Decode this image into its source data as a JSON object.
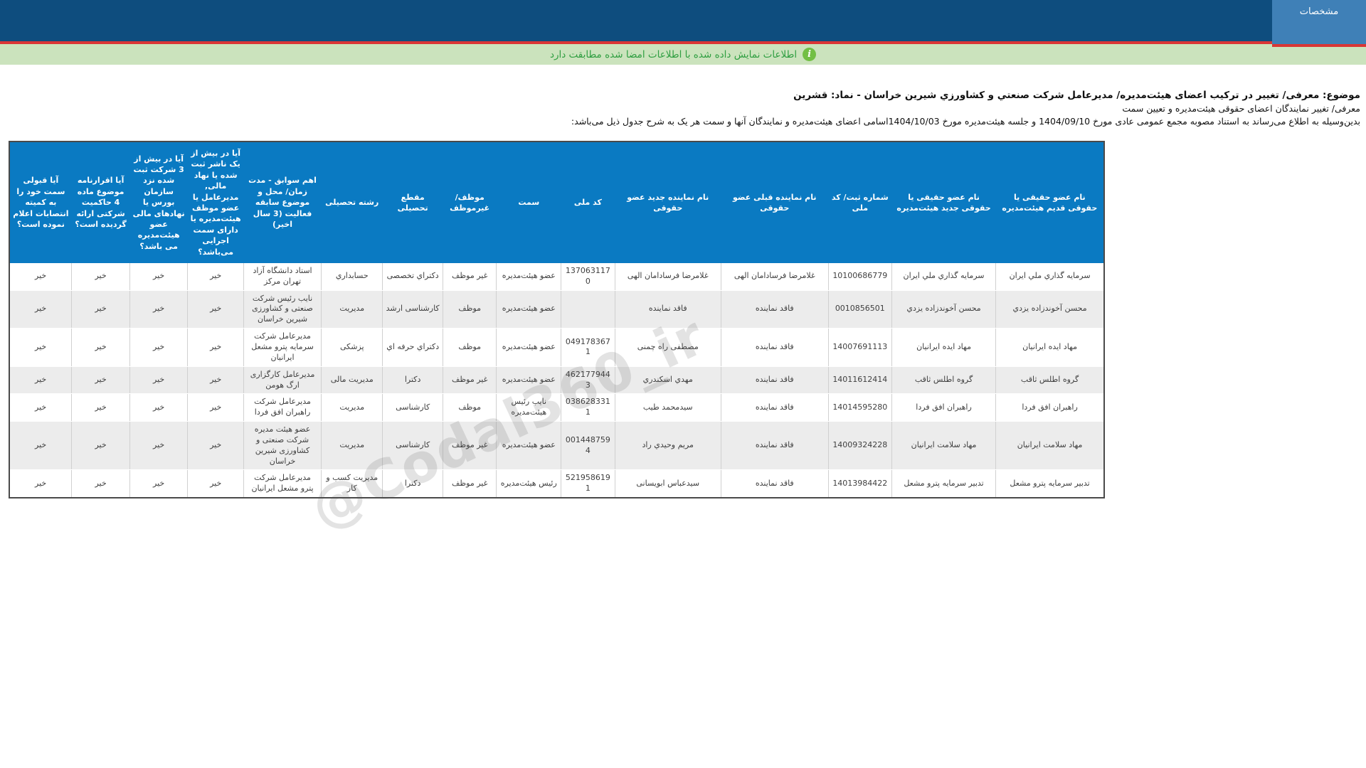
{
  "colors": {
    "navy": "#0e4d7e",
    "tab_blue": "#3f80b7",
    "red": "#d93636",
    "green_bg": "#cbe3bd",
    "green_text": "#2f9e41",
    "icon_green": "#72bf44",
    "accent_blue": "#0a7ac2"
  },
  "topbar": {
    "tab_label": "مشخصات"
  },
  "infobar": {
    "icon": "info-icon",
    "message": "اطلاعات نمایش داده شده با اطلاعات امضا شده مطابقت دارد"
  },
  "document": {
    "subject": "موضوع: معرفی/ تغییر در ترکیب اعضای هیئت‌مدیره/ مدیرعامل شرکت صنعتي و کشاورزي شیرین خراسان - نماد: قشرین",
    "subtitle": "معرفی/ تغییر نمایندگان اعضای حقوقی هیئت‌مدیره و تعیین سمت",
    "description": "بدین‌وسیله به اطلاع می‌رساند به استناد مصوبه مجمع عمومی عادی مورخ  1404/09/10  و جلسه هیئت‌مدیره مورخ 1404/10/03اسامی اعضای هیئت‌مدیره و نمایندگان آنها و سمت هر یک به شرح جدول ذیل می‌باشد:",
    "general_assembly_date": "1404/09/10",
    "board_meeting_date": "1404/10/03"
  },
  "table": {
    "columns": [
      "نام عضو حقیقی یا حقوقی قدیم هیئت‌مدیره",
      "نام عضو حقیقی یا حقوقی جدید هیئت‌مدیره",
      "شماره ثبت/ کد ملی",
      "نام نماینده قبلی عضو حقوقی",
      "نام نماینده جدید عضو حقوقی",
      "کد ملی",
      "سمت",
      "موظف/ غیرموظف",
      "مقطع تحصیلی",
      "رشته تحصیلی",
      "اهم سوابق - مدت زمان/ محل و موضوع سابقه فعالیت (3 سال اخیر)",
      "آیا در بیش از یک ناشر ثبت شده یا نهاد مالی, مدیرعامل یا عضو موظف هیئت‌مدیره یا دارای سمت اجرایی می‌باشد؟",
      "آیا در بیش از 3 شرکت ثبت شده نزد سازمان بورس یا نهادهای مالی عضو هیئت‌مدیره می باشد؟",
      "آیا اقرارنامه موضوع ماده 4 حاکمیت شرکتی ارائه گردیده است؟",
      "آیا قبولی سمت خود را به کمیته انتصابات اعلام نموده است؟"
    ],
    "rows": [
      [
        "سرمایه گذاري ملي ایران",
        "سرمایه گذاري ملي ایران",
        "10100686779",
        "غلامرضا فرسادامان الهی",
        "غلامرضا فرسادامان الهی",
        "1370631170",
        "عضو هیئت‌مدیره",
        "غیر موظف",
        "دکتراي تخصصی",
        "حسابداري",
        "استاد دانشگاه آزاد تهران مرکز",
        "خیر",
        "خیر",
        "خیر",
        "خیر"
      ],
      [
        "محسن آخوندزاده یزدي",
        "محسن آخوندزاده یزدي",
        "0010856501",
        "فاقد نماینده",
        "فاقد نماینده",
        "",
        "عضو هیئت‌مدیره",
        "موظف",
        "کارشناسی ارشد",
        "مدیریت",
        "نایب رئیس شرکت صنعتی و کشاورزی شیرین خراسان",
        "خیر",
        "خیر",
        "خیر",
        "خیر"
      ],
      [
        "مهاد ایده ایرانیان",
        "مهاد ایده ایرانیان",
        "14007691113",
        "فاقد نماینده",
        "مصطفی راه چمنی",
        "0491783671",
        "عضو هیئت‌مدیره",
        "موظف",
        "دکتراي حرفه اي",
        "پزشکی",
        "مدیرعامل شرکت سرمایه پترو مشعل ایرانیان",
        "خیر",
        "خیر",
        "خیر",
        "خیر"
      ],
      [
        "گروه اطلس ثاقب",
        "گروه اطلس ثاقب",
        "14011612414",
        "فاقد نماینده",
        "مهدي اسکندري",
        "4621779443",
        "عضو هیئت‌مدیره",
        "غیر موظف",
        "دکترا",
        "مدیریت مالی",
        "مدیرعامل کارگزاری ارگ هومن",
        "خیر",
        "خیر",
        "خیر",
        "خیر"
      ],
      [
        "راهبران افق فردا",
        "راهبران افق فردا",
        "14014595280",
        "فاقد نماینده",
        "سیدمحمد طیب",
        "0386283311",
        "نایب رئیس هیئت‌مدیره",
        "موظف",
        "کارشناسی",
        "مدیریت",
        "مدیرعامل شرکت راهبران افق فردا",
        "خیر",
        "خیر",
        "خیر",
        "خیر"
      ],
      [
        "مهاد سلامت ایرانیان",
        "مهاد سلامت ایرانیان",
        "14009324228",
        "فاقد نماینده",
        "مریم وحیدي راد",
        "0014487594",
        "عضو هیئت‌مدیره",
        "غیر موظف",
        "کارشناسی",
        "مدیریت",
        "عضو هیئت مدیره شرکت صنعتی و کشاورزی شیرین خراسان",
        "خیر",
        "خیر",
        "خیر",
        "خیر"
      ],
      [
        "تدبیر سرمایه پترو مشعل",
        "تدبیر سرمایه پترو مشعل",
        "14013984422",
        "فاقد نماینده",
        "سیدعباس ابویسانی",
        "5219586191",
        "رئیس هیئت‌مدیره",
        "غیر موظف",
        "دکترا",
        "مدیریت کسب و کار",
        "مدیرعامل شرکت پترو مشعل ایرانیان",
        "خیر",
        "خیر",
        "خیر",
        "خیر"
      ]
    ]
  },
  "watermark": {
    "text": "@Codal360_ir"
  }
}
